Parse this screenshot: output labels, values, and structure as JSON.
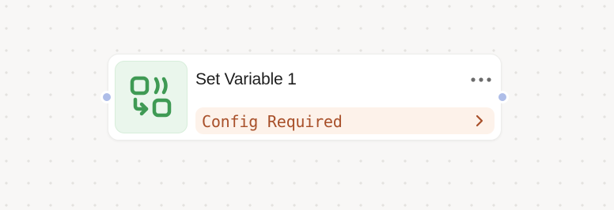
{
  "node": {
    "title": "Set Variable 1",
    "icon": "set-variable-icon",
    "status": {
      "label": "Config Required",
      "icon": "chevron-right-icon"
    },
    "menu_icon": "more-horizontal-icon"
  },
  "colors": {
    "canvas_bg": "#f8f7f6",
    "icon_green": "#3f9a54",
    "icon_bg": "#eaf6ec",
    "warning_text": "#a8502a",
    "warning_bg": "#fdf2ea",
    "handle": "#aebde8"
  }
}
